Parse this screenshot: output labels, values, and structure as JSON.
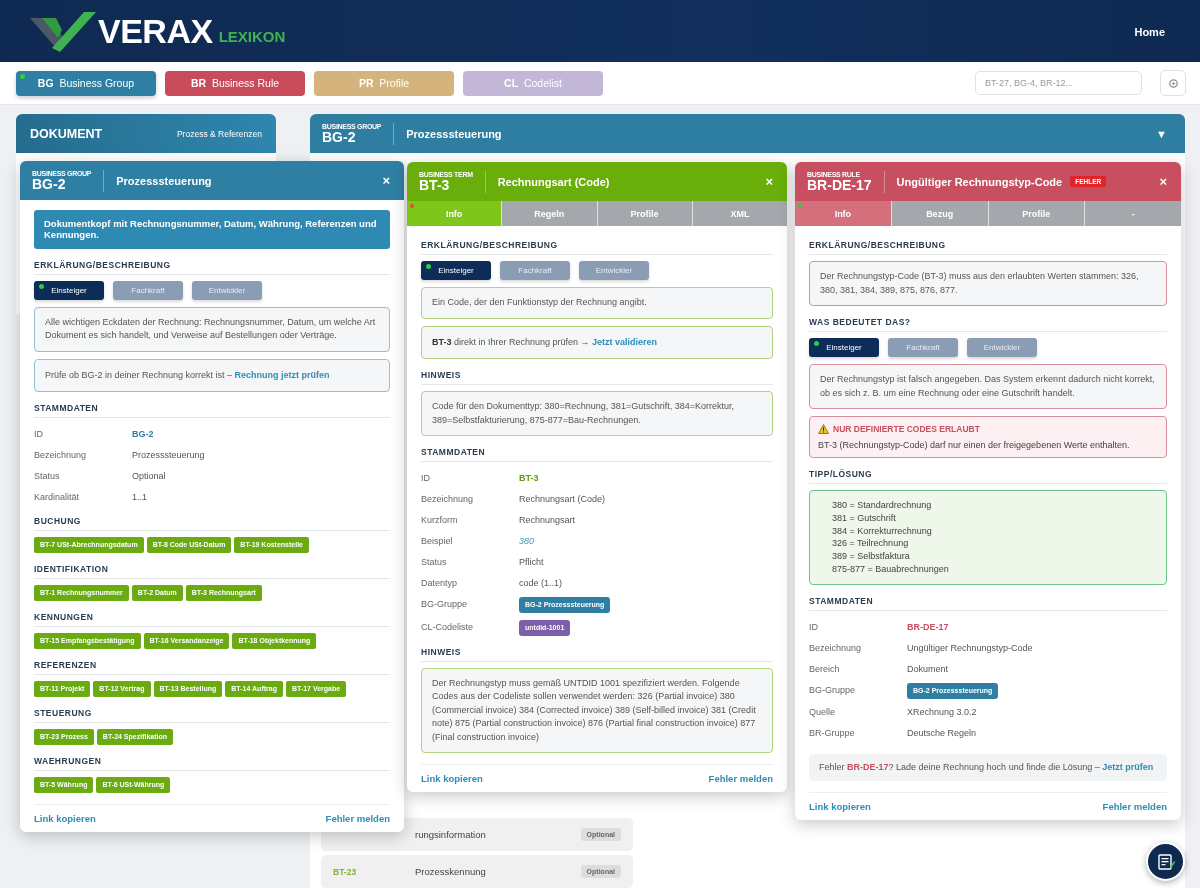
{
  "header": {
    "logo_main": "VERAX",
    "logo_sub": "LEXIKON",
    "nav": [
      {
        "label": "Home"
      }
    ]
  },
  "filters": [
    {
      "code": "BG",
      "label": "Business Group",
      "selected": true,
      "color": "#2e7fa3"
    },
    {
      "code": "BR",
      "label": "Business Rule",
      "selected": false,
      "color": "#c84b5c"
    },
    {
      "code": "PR",
      "label": "Profile",
      "selected": false,
      "color": "#d4b47c"
    },
    {
      "code": "CL",
      "label": "Codelist",
      "selected": false,
      "color": "#c3b7d8"
    }
  ],
  "search": {
    "placeholder": "BT-27, BG-4, BR-12..."
  },
  "document_panel": {
    "title": "DOKUMENT",
    "subtitle": "Prozess & Referenzen"
  },
  "group_panel": {
    "type_label": "BUSINESS GROUP",
    "id": "BG-2",
    "title": "Prozesssteuerung",
    "toggle": "▼",
    "rows": [
      {
        "name": "rungsinformation",
        "status": "Optional"
      },
      {
        "code": "BT-23",
        "name": "Prozesskennung",
        "status": "Optional"
      }
    ]
  },
  "popups": [
    {
      "kind": "group",
      "type_label": "BUSINESS GROUP",
      "id": "BG-2",
      "title": "Prozesssteuerung",
      "close": "×",
      "sections": [
        {
          "kind": "intro",
          "text": "Dokumentkopf mit Rechnungsnummer, Datum, Währung, Referenzen und Kennungen."
        },
        {
          "kind": "heading",
          "text": "ERKLÄRUNG/BESCHREIBUNG"
        },
        {
          "kind": "levels",
          "items": [
            {
              "label": "Einsteiger",
              "selected": true
            },
            {
              "label": "Fachkraft",
              "selected": false
            },
            {
              "label": "Entwickler",
              "selected": false
            }
          ]
        },
        {
          "kind": "text",
          "text": "Alle wichtigen Eckdaten der Rechnung: Rechnungsnummer, Datum, um welche Art Dokument es sich handelt, und Verweise auf Bestellungen oder Verträge."
        },
        {
          "kind": "cta",
          "text": "Prüfe ob BG-2 in deiner Rechnung korrekt ist – ",
          "link": "Rechnung jetzt prüfen"
        },
        {
          "kind": "heading",
          "text": "STAMMDATEN"
        },
        {
          "kind": "fields",
          "rows": [
            {
              "label": "ID",
              "value": "BG-2",
              "kind": "id"
            },
            {
              "label": "Bezeichnung",
              "value": "Prozesssteuerung",
              "kind": "plain"
            },
            {
              "label": "Status",
              "value": "Optional",
              "kind": "plain"
            },
            {
              "label": "Kardinalität",
              "value": "1..1",
              "kind": "plain"
            }
          ]
        },
        {
          "kind": "heading",
          "text": "BUCHUNG"
        },
        {
          "kind": "tags",
          "items": [
            "BT-7 USt-Abrechnungsdatum",
            "BT-8 Code USt-Datum",
            "BT-19 Kostenstelle"
          ]
        },
        {
          "kind": "heading",
          "text": "IDENTIFIKATION"
        },
        {
          "kind": "tags",
          "items": [
            "BT-1 Rechnungsnummer",
            "BT-2 Datum",
            "BT-3 Rechnungsart"
          ]
        },
        {
          "kind": "heading",
          "text": "KENNUNGEN"
        },
        {
          "kind": "tags",
          "items": [
            "BT-15 Empfangsbestätigung",
            "BT-16 Versandanzeige",
            "BT-18 Objektkennung"
          ]
        },
        {
          "kind": "heading",
          "text": "REFERENZEN"
        },
        {
          "kind": "tags",
          "items": [
            "BT-11 Projekt",
            "BT-12 Vertrag",
            "BT-13 Bestellung",
            "BT-14 Auftrag",
            "BT-17 Vergabe"
          ]
        },
        {
          "kind": "heading",
          "text": "STEUERUNG"
        },
        {
          "kind": "tags",
          "items": [
            "BT-23 Prozess",
            "BT-24 Spezifikation"
          ]
        },
        {
          "kind": "heading",
          "text": "WAEHRUNGEN"
        },
        {
          "kind": "tags",
          "items": [
            "BT-5 Währung",
            "BT-6 USt-Währung"
          ]
        }
      ],
      "footer": [
        "Link kopieren",
        "Fehler melden"
      ]
    },
    {
      "kind": "term",
      "type_label": "BUSINESS TERM",
      "id": "BT-3",
      "title": "Rechnungsart (Code)",
      "close": "×",
      "tabs": [
        {
          "label": "Info",
          "selected": true,
          "color": "#e5483b"
        },
        {
          "label": "Regeln",
          "selected": false
        },
        {
          "label": "Profile",
          "selected": false
        },
        {
          "label": "XML",
          "selected": false
        }
      ],
      "sections": [
        {
          "kind": "heading",
          "text": "ERKLÄRUNG/BESCHREIBUNG"
        },
        {
          "kind": "levels",
          "items": [
            {
              "label": "Einsteiger",
              "selected": true
            },
            {
              "label": "Fachkraft",
              "selected": false
            },
            {
              "label": "Entwickler",
              "selected": false
            }
          ]
        },
        {
          "kind": "text",
          "text": "Ein Code, der den Funktionstyp der Rechnung angibt."
        },
        {
          "kind": "cta",
          "text": "**BT-3** direkt in Ihrer Rechnung prüfen → ",
          "link": "Jetzt validieren"
        },
        {
          "kind": "heading",
          "text": "HINWEIS"
        },
        {
          "kind": "text",
          "text": "Code für den Dokumenttyp: 380=Rechnung, 381=Gutschrift, 384=Korrektur, 389=Selbstfakturierung, 875-877=Bau-Rechnungen."
        },
        {
          "kind": "heading",
          "text": "STAMMDATEN"
        },
        {
          "kind": "fields",
          "rows": [
            {
              "label": "ID",
              "value": "BT-3",
              "kind": "id"
            },
            {
              "label": "Bezeichnung",
              "value": "Rechnungsart (Code)",
              "kind": "plain"
            },
            {
              "label": "Kurzform",
              "value": "Rechnungsart",
              "kind": "plain"
            },
            {
              "label": "Beispiel",
              "value": "380",
              "kind": "example"
            },
            {
              "label": "Status",
              "value": "Pflicht",
              "kind": "plain"
            },
            {
              "label": "Datentyp",
              "value": "code (1..1)",
              "kind": "plain"
            },
            {
              "label": "BG-Gruppe",
              "value": "BG-2 Prozesssteuerung",
              "kind": "chip",
              "color": "#2e7fa3"
            },
            {
              "label": "CL-Codeliste",
              "value": "untdid-1001",
              "kind": "chip",
              "color": "#7d5ea8"
            }
          ]
        },
        {
          "kind": "heading",
          "text": "HINWEIS"
        },
        {
          "kind": "text",
          "text": "Der Rechnungstyp muss gemäß UNTDID 1001 spezifiziert werden. Folgende Codes aus der Codeliste sollen verwendet werden: 326 (Partial invoice) 380 (Commercial invoice) 384 (Corrected invoice) 389 (Self-billed invoice) 381 (Credit note) 875 (Partial construction invoice) 876 (Partial final construction invoice) 877 (Final construction invoice)"
        }
      ],
      "footer": [
        "Link kopieren",
        "Fehler melden"
      ]
    },
    {
      "kind": "rule",
      "type_label": "BUSINESS RULE",
      "id": "BR-DE-17",
      "title": "Ungültiger Rechnungstyp-Code",
      "badge": "FEHLER",
      "close": "×",
      "tabs": [
        {
          "label": "Info",
          "selected": true,
          "color": "#2ecc40"
        },
        {
          "label": "Bezug",
          "selected": false
        },
        {
          "label": "Profile",
          "selected": false
        },
        {
          "label": "-",
          "selected": false
        }
      ],
      "sections": [
        {
          "kind": "heading",
          "text": "ERKLÄRUNG/BESCHREIBUNG"
        },
        {
          "kind": "text",
          "text": "Der Rechnungstyp-Code (BT-3) muss aus den erlaubten Werten stammen: 326, 380, 381, 384, 389, 875, 876, 877."
        },
        {
          "kind": "heading",
          "text": "WAS BEDEUTET DAS?"
        },
        {
          "kind": "levels",
          "items": [
            {
              "label": "Einsteiger",
              "selected": true
            },
            {
              "label": "Fachkraft",
              "selected": false
            },
            {
              "label": "Entwickler",
              "selected": false
            }
          ]
        },
        {
          "kind": "text",
          "text": "Der Rechnungstyp ist falsch angegeben. Das System erkennt dadurch nicht korrekt, ob es sich z. B. um eine Rechnung oder eine Gutschrift handelt."
        },
        {
          "kind": "warning",
          "title": "NUR DEFINIERTE CODES ERLAUBT",
          "text": "BT-3 (Rechnungstyp-Code) darf nur einen der freigegebenen Werte enthalten."
        },
        {
          "kind": "heading",
          "text": "TIPP/LÖSUNG"
        },
        {
          "kind": "codes",
          "lines": [
            "380 = Standardrechnung",
            "381 = Gutschrift",
            "384 = Korrekturrechnung",
            "326 = Teilrechnung",
            "389 = Selbstfaktura",
            "875-877 = Bauabrechnungen"
          ]
        },
        {
          "kind": "heading",
          "text": "STAMMDATEN"
        },
        {
          "kind": "fields",
          "rows": [
            {
              "label": "ID",
              "value": "BR-DE-17",
              "kind": "id"
            },
            {
              "label": "Bezeichnung",
              "value": "Ungültiger Rechnungstyp-Code",
              "kind": "plain"
            },
            {
              "label": "Bereich",
              "value": "Dokument",
              "kind": "plain"
            },
            {
              "label": "BG-Gruppe",
              "value": "BG-2 Prozesssteuerung",
              "kind": "chip",
              "color": "#2e7fa3"
            },
            {
              "label": "Quelle",
              "value": "XRechnung 3.0.2",
              "kind": "plain"
            },
            {
              "label": "BR-Gruppe",
              "value": "Deutsche Regeln",
              "kind": "plain"
            }
          ]
        },
        {
          "kind": "callout",
          "text": "Fehler **BR-DE-17**? Lade deine Rechnung hoch und finde die Lösung – ",
          "link": "Jetzt prüfen"
        }
      ],
      "footer": [
        "Link kopieren",
        "Fehler melden"
      ]
    }
  ]
}
